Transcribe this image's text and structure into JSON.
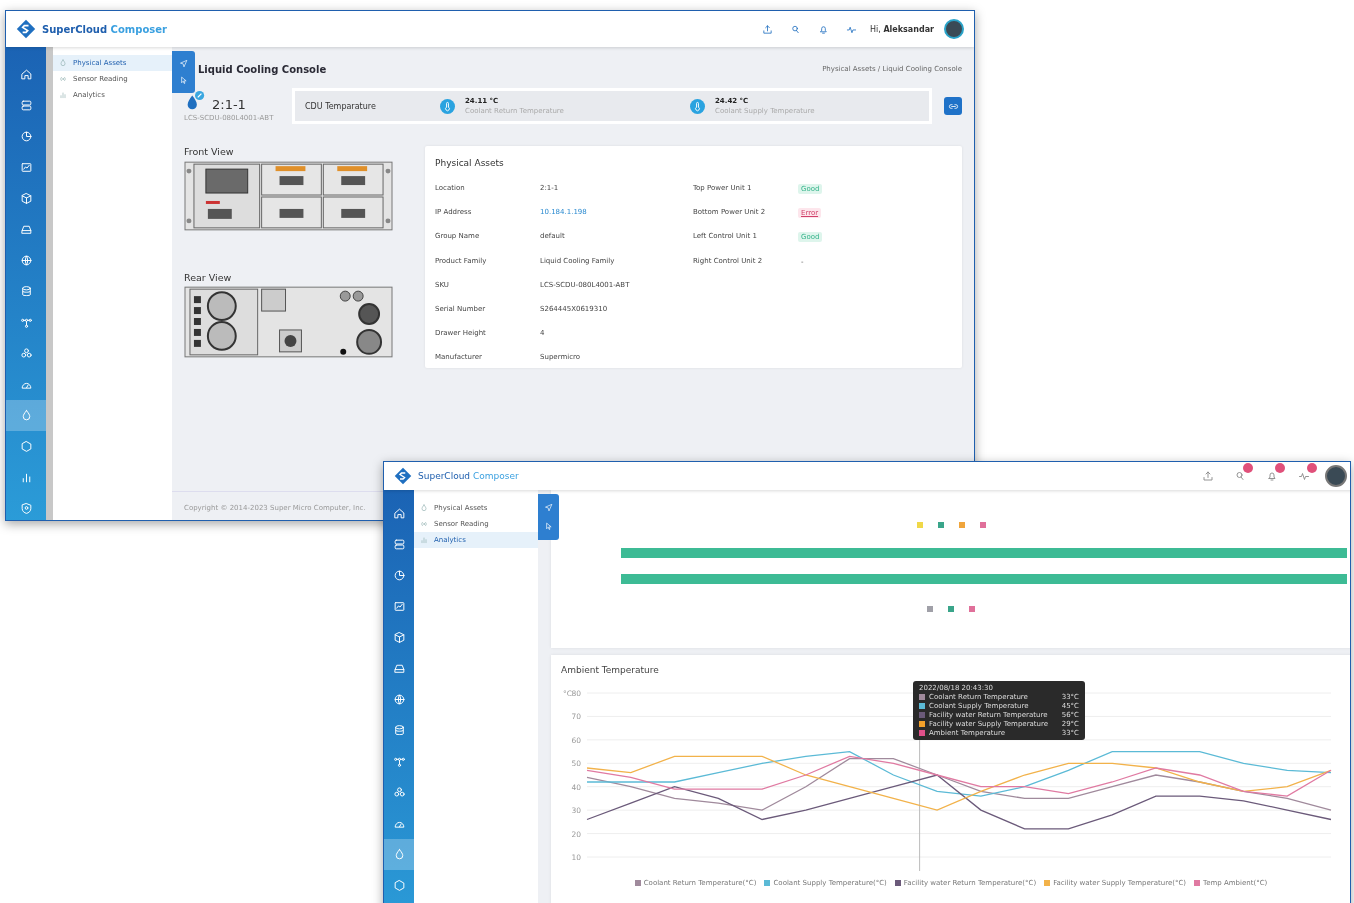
{
  "window_1": {
    "header": {
      "app_name": "SuperCloud",
      "app_name_suffix": "Composer",
      "greeting": "Hi, **Aleksandar**"
    },
    "nav_rail": [
      {
        "selected": false
      },
      {
        "selected": false
      },
      {
        "selected": false
      },
      {
        "selected": false
      },
      {
        "selected": false
      },
      {
        "selected": false
      },
      {
        "selected": false
      },
      {
        "selected": false
      },
      {
        "selected": false
      },
      {
        "selected": false
      },
      {
        "selected": false
      },
      {
        "selected": true
      },
      {
        "selected": false
      },
      {
        "selected": false
      },
      {
        "selected": false
      }
    ],
    "sidebar": {
      "items": [
        {
          "label": "Physical Assets",
          "selected": true
        },
        {
          "label": "Sensor Reading",
          "selected": false
        },
        {
          "label": "Analytics",
          "selected": false
        }
      ]
    },
    "page_title": "Liquid Cooling Console",
    "breadcrumb": "Physical Assets / Liquid Cooling Console",
    "device": {
      "name": "2:1-1",
      "sku": "LCS-SCDU-080L4001-ABT"
    },
    "cdu": {
      "title": "CDU Temparature",
      "readings": [
        {
          "value": "24.11 °C",
          "label": "Coolant Return Temperature"
        },
        {
          "value": "24.42 °C",
          "label": "Coolant Supply Temperature"
        }
      ]
    },
    "front_view": {
      "title": "Front View"
    },
    "rear_view": {
      "title": "Rear View"
    },
    "physical_assets": {
      "title": "Physical Assets",
      "fields": [
        {
          "label": "Location",
          "value": "2:1-1",
          "kind": "text"
        },
        {
          "label": "IP Address",
          "value": "10.184.1.198",
          "kind": "link"
        },
        {
          "label": "Group Name",
          "value": "default",
          "kind": "text"
        },
        {
          "label": "Product Family",
          "value": "Liquid Cooling Family",
          "kind": "text"
        },
        {
          "label": "SKU",
          "value": "LCS-SCDU-080L4001-ABT",
          "kind": "text"
        },
        {
          "label": "Serial Number",
          "value": "S264445X0619310",
          "kind": "text"
        },
        {
          "label": "Drawer Height",
          "value": "4",
          "kind": "text"
        },
        {
          "label": "Manufacturer",
          "value": "Supermicro",
          "kind": "text"
        }
      ],
      "units": [
        {
          "label": "Top Power Unit 1",
          "status": "Good",
          "kind": "good"
        },
        {
          "label": "Bottom Power Unit 2",
          "status": "Error",
          "kind": "error"
        },
        {
          "label": "Left Control Unit 1",
          "status": "Good",
          "kind": "good"
        },
        {
          "label": "Right Control Unit 2",
          "status": "-",
          "kind": "none"
        }
      ]
    },
    "footer": "Copyright © 2014-2023 Super Micro Computer, Inc."
  },
  "window_2": {
    "header": {
      "app_name": "SuperCloud",
      "app_name_suffix": "Composer",
      "toolbar": [
        {
          "badge": false
        },
        {
          "badge": true
        },
        {
          "badge": true
        },
        {
          "badge": true
        }
      ]
    },
    "nav_rail": [
      {
        "selected": false
      },
      {
        "selected": false
      },
      {
        "selected": false
      },
      {
        "selected": false
      },
      {
        "selected": false
      },
      {
        "selected": false
      },
      {
        "selected": false
      },
      {
        "selected": false
      },
      {
        "selected": false
      },
      {
        "selected": false
      },
      {
        "selected": false
      },
      {
        "selected": true
      },
      {
        "selected": false
      }
    ],
    "sidebar": {
      "items": [
        {
          "label": "Physical Assets",
          "selected": false
        },
        {
          "label": "Sensor Reading",
          "selected": false
        },
        {
          "label": "Analytics",
          "selected": true
        }
      ]
    },
    "status_chart": {
      "legend_top": [
        {
          "color": "#f0d848"
        },
        {
          "color": "#3aa58a"
        },
        {
          "color": "#f0a53c"
        },
        {
          "color": "#e0709a"
        }
      ],
      "rows": [
        {
          "color": "#3dbb95"
        },
        {
          "color": "#3dbb95"
        }
      ],
      "legend_bottom": [
        {
          "color": "#a0a0a8"
        },
        {
          "color": "#3aa58a"
        },
        {
          "color": "#e0709a"
        }
      ]
    },
    "ambient": {
      "title": "Ambient Temperature",
      "chart_data": {
        "type": "line",
        "grid": true,
        "ylabel": "°C",
        "ylim": [
          10,
          80
        ],
        "yticks": [
          10,
          20,
          30,
          40,
          50,
          60,
          70,
          80
        ],
        "series": [
          {
            "name": "Coolant Return Temperature(°C)",
            "color": "#a08a9c",
            "values": [
              44,
              40,
              35,
              33,
              30,
              40,
              52,
              52,
              45,
              38,
              35,
              35,
              40,
              45,
              42,
              38,
              35,
              30
            ]
          },
          {
            "name": "Coolant Supply Temperature(°C)",
            "color": "#5bbad6",
            "values": [
              42,
              42,
              42,
              46,
              50,
              53,
              55,
              45,
              38,
              36,
              40,
              47,
              55,
              55,
              55,
              50,
              47,
              46
            ]
          },
          {
            "name": "Facility water Return Temperature(°C)",
            "color": "#6b5a7a",
            "values": [
              26,
              33,
              40,
              35,
              26,
              30,
              35,
              40,
              45,
              30,
              22,
              22,
              28,
              36,
              36,
              34,
              30,
              26
            ]
          },
          {
            "name": "Facility water Supply Temperature(°C)",
            "color": "#f2b24a",
            "values": [
              48,
              46,
              53,
              53,
              53,
              45,
              40,
              35,
              30,
              38,
              45,
              50,
              50,
              48,
              42,
              38,
              40,
              47
            ]
          },
          {
            "name": "Temp Ambient(°C)",
            "color": "#e07aa2",
            "values": [
              47,
              44,
              39,
              39,
              39,
              45,
              53,
              50,
              45,
              40,
              40,
              37,
              42,
              48,
              45,
              38,
              36,
              47
            ]
          }
        ]
      },
      "tooltip": {
        "date": "2022/08/18 20:43:30",
        "rows": [
          {
            "label": "Coolant Return Temperature",
            "value": "33°C",
            "color": "#a08a9c"
          },
          {
            "label": "Coolant Supply Temperature",
            "value": "45°C",
            "color": "#5bbad6"
          },
          {
            "label": "Facility water Return Temperature",
            "value": "56°C",
            "color": "#6b5a7a"
          },
          {
            "label": "Facility water Supply Temperature",
            "value": "29°C",
            "color": "#f2a02a"
          },
          {
            "label": "Ambient Temperature",
            "value": "33°C",
            "color": "#e0508a"
          }
        ]
      }
    }
  }
}
